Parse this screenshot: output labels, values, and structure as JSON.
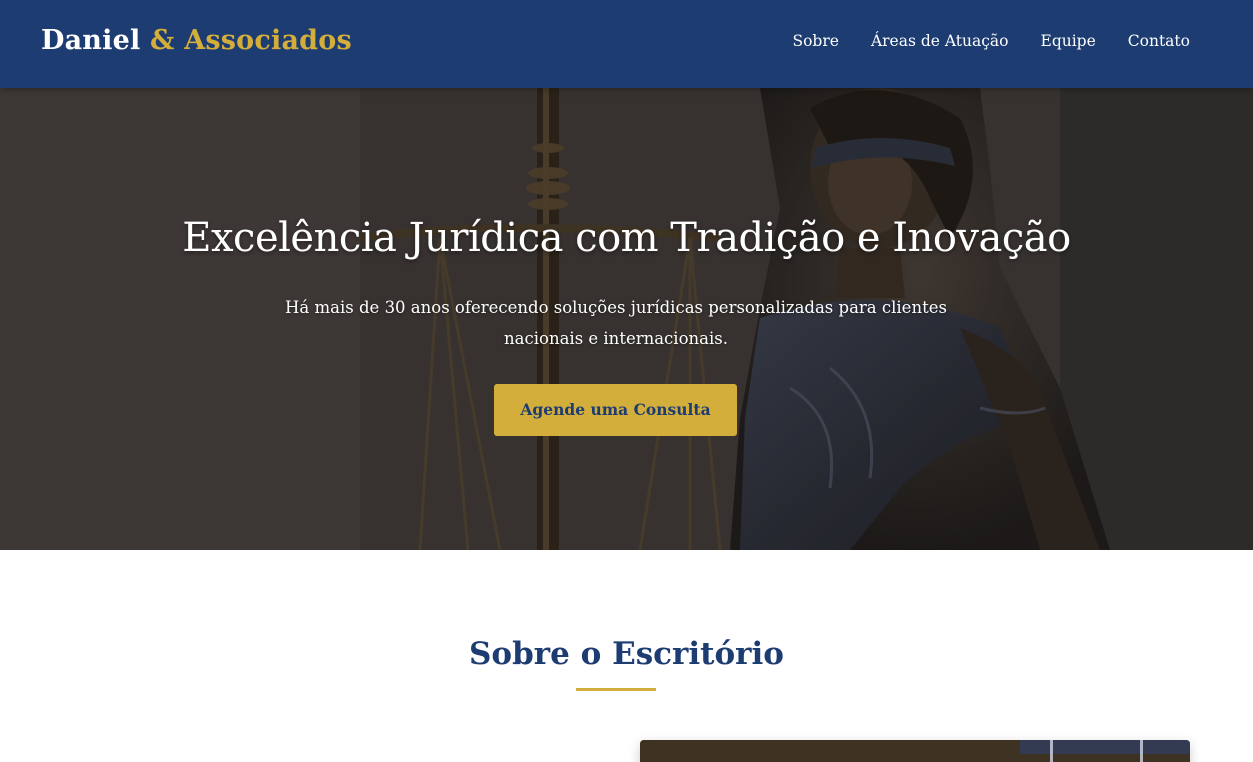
{
  "brand": {
    "name_main": "Daniel",
    "name_accent": "& Associados"
  },
  "nav": {
    "items": [
      {
        "label": "Sobre"
      },
      {
        "label": "Áreas de Atuação"
      },
      {
        "label": "Equipe"
      },
      {
        "label": "Contato"
      }
    ]
  },
  "hero": {
    "title": "Excelência Jurídica com Tradição e Inovação",
    "subtitle": "Há mais de 30 anos oferecendo soluções jurídicas personalizadas para clientes nacionais e internacionais.",
    "cta_label": "Agende uma Consulta"
  },
  "about": {
    "title": "Sobre o Escritório"
  },
  "colors": {
    "primary": "#1c3c72",
    "accent": "#d4ae3a",
    "text_light": "#ffffff"
  }
}
